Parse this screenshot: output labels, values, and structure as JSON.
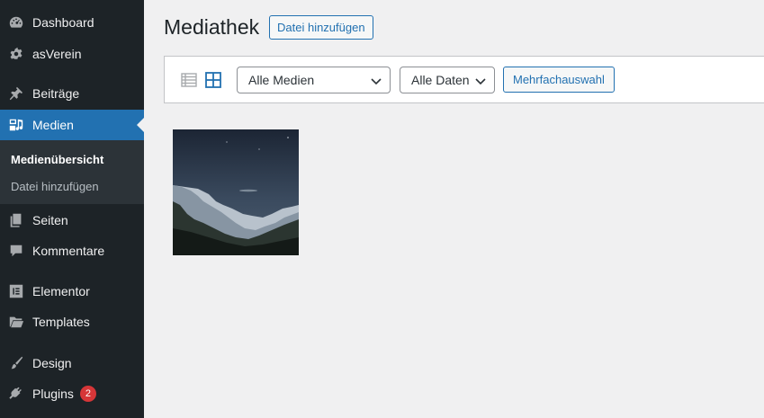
{
  "sidebar": {
    "items": [
      {
        "label": "Dashboard",
        "icon": "dashboard-icon"
      },
      {
        "label": "asVerein",
        "icon": "gear-icon"
      },
      {
        "label": "Beiträge",
        "icon": "pushpin-icon"
      },
      {
        "label": "Medien",
        "icon": "media-icon",
        "active": true
      },
      {
        "label": "Seiten",
        "icon": "pages-icon"
      },
      {
        "label": "Kommentare",
        "icon": "comment-icon"
      },
      {
        "label": "Elementor",
        "icon": "elementor-icon"
      },
      {
        "label": "Templates",
        "icon": "folder-icon"
      },
      {
        "label": "Design",
        "icon": "paintbrush-icon"
      },
      {
        "label": "Plugins",
        "icon": "plugin-icon",
        "badge": "2"
      }
    ],
    "submenu": [
      {
        "label": "Medienübersicht",
        "current": true
      },
      {
        "label": "Datei hinzufügen"
      }
    ]
  },
  "main": {
    "title": "Mediathek",
    "add_button": "Datei hinzufügen",
    "toolbar": {
      "filter_media": "Alle Medien",
      "filter_dates": "Alle Daten",
      "bulk_select": "Mehrfachauswahl"
    }
  },
  "colors": {
    "sidebar_bg": "#1d2327",
    "accent": "#2271b1",
    "badge": "#d63638",
    "page_bg": "#f0f0f1"
  }
}
